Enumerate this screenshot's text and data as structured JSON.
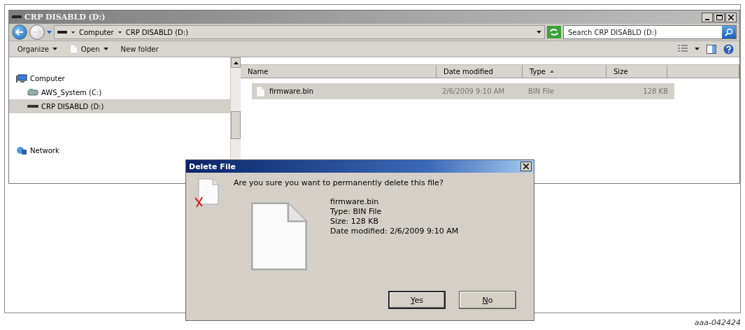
{
  "window": {
    "title": "CRP DISABLD (D:)"
  },
  "address": {
    "crumbs": [
      "Computer",
      "CRP DISABLD (D:)"
    ]
  },
  "search": {
    "placeholder": "Search CRP DISABLD (D:)"
  },
  "toolbar": {
    "items": [
      {
        "kind": "menu",
        "label": "Organize"
      },
      {
        "kind": "open",
        "label": "Open"
      },
      {
        "kind": "plain",
        "label": "New folder"
      }
    ]
  },
  "nav": {
    "items": [
      {
        "kind": "computer",
        "label": "Computer",
        "selected": false,
        "children": [
          {
            "kind": "drive",
            "label": "AWS_System (C:)",
            "selected": false
          },
          {
            "kind": "usb",
            "label": "CRP DISABLD (D:)",
            "selected": true
          }
        ]
      },
      {
        "kind": "network",
        "label": "Network",
        "selected": false
      }
    ]
  },
  "table": {
    "columns": [
      {
        "label": "Name",
        "sorted": false
      },
      {
        "label": "Date modified",
        "sorted": false
      },
      {
        "label": "Type",
        "sorted": true
      },
      {
        "label": "Size",
        "sorted": false
      }
    ],
    "rows": [
      {
        "name": "firmware.bin",
        "date": "2/6/2009 9:10 AM",
        "type": "BIN File",
        "size": "128 KB",
        "selected": true
      }
    ]
  },
  "dialog": {
    "title": "Delete File",
    "question": "Are you sure you want to permanently delete this file?",
    "details": [
      "firmware.bin",
      "Type: BIN File",
      "Size: 128 KB",
      "Date modified: 2/6/2009 9:10 AM"
    ],
    "buttons": [
      {
        "accel": "Y",
        "rest": "es",
        "default": true
      },
      {
        "accel": "N",
        "rest": "o",
        "default": false
      }
    ]
  },
  "figure_label": "aaa-042424"
}
